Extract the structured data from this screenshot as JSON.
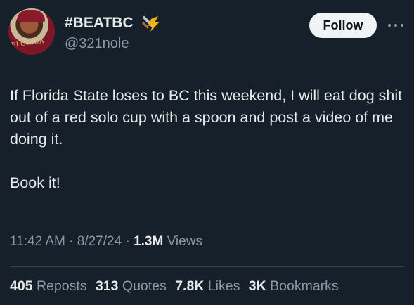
{
  "author": {
    "display_name": "#BEATBC",
    "handle": "@321nole",
    "avatar_text": "FLORIDA",
    "badge_icon": "bolt-icon"
  },
  "follow_label": "Follow",
  "tweet": {
    "paragraphs": [
      "If Florida State loses to BC this weekend, I will eat dog shit out of a red solo cup with a spoon and post a video of me doing it.",
      "Book it!"
    ]
  },
  "meta": {
    "time": "11:42 AM",
    "date": "8/27/24",
    "views_count": "1.3M",
    "views_label": "Views"
  },
  "stats": {
    "reposts": {
      "count": "405",
      "label": "Reposts"
    },
    "quotes": {
      "count": "313",
      "label": "Quotes"
    },
    "likes": {
      "count": "7.8K",
      "label": "Likes"
    },
    "bookmarks": {
      "count": "3K",
      "label": "Bookmarks"
    }
  },
  "colors": {
    "background": "#15202b",
    "text": "#e7e9ea",
    "muted": "#8b98a5",
    "follow_bg": "#eff3f4"
  }
}
